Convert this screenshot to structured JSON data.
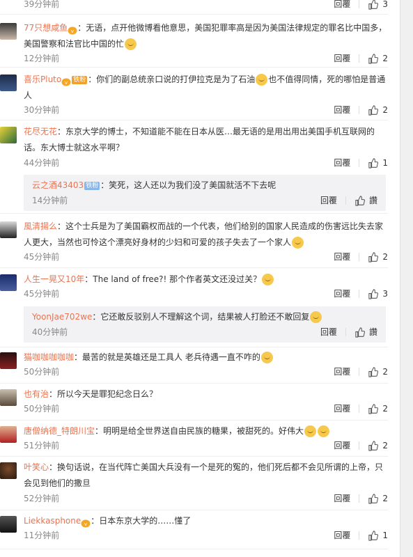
{
  "reply_label": "回覆",
  "sub_like_label": "讚",
  "comments": [
    {
      "text": "",
      "time": "39分钟前",
      "likes": "3"
    },
    {
      "name": "77只想咸鱼",
      "text": "：无语，点开他微博看他意思，美国犯罪率高是因为美国法律规定的罪名比中国多，美国警察和法官比中国的忙",
      "time": "12分钟前",
      "likes": "2"
    },
    {
      "name": "喜乐Pluto",
      "badge": "铁粉",
      "text": "：你们的副总统亲口说的打伊拉克是为了石油",
      "text2": "也不值得同情，死的哪怕是普通人",
      "time": "30分钟前",
      "likes": "2"
    },
    {
      "name": "花尽无花",
      "text": "：东京大学的博士，不知道能不能在日本从医…最无语的是用出用出美国手机互联网的话。东大博士就这水平啊？",
      "time": "44分钟前",
      "likes": "1",
      "sub": {
        "name": "云之酒43403",
        "badge": "铁粉",
        "text": "：笑死，这人还以为我们没了美国就活不下去呢",
        "time": "14分钟前"
      }
    },
    {
      "name": "風清揚么",
      "text": "：这个士兵是为了美国霸权而战的一个代表，他们给别的国家人民造成的伤害远比失去家人更大，当然也可怜这个漂亮好身材的少妇和可爱的孩子失去了一个家人",
      "time": "45分钟前",
      "likes": "2"
    },
    {
      "name": "人生一晃又10年",
      "text": "：The land of free?! 那个作者英文还没过关？",
      "time": "45分钟前",
      "likes": "3",
      "sub": {
        "name": "YoonJae702we",
        "text": "：它还敢反驳别人不理解这个词，结果被人打脸还不敢回复",
        "time": "40分钟前"
      }
    },
    {
      "name": "猫咖咖咖咖咖",
      "text": "：最苦的就是英雄还是工具人 老兵待遇一直不咋的",
      "time": "50分钟前",
      "likes": "2"
    },
    {
      "name": "也有治",
      "text": "：所以今天是罪犯纪念日么？",
      "time": "50分钟前",
      "likes": "2"
    },
    {
      "name": "唐僧纳德_特朗川宝",
      "text": "：明明是给全世界送自由民族的糖果，被甜死的。好伟大",
      "time": "51分钟前",
      "likes": "2"
    },
    {
      "name": "叶笑心",
      "text": "：换句话说，在当代阵亡美国大兵没有一个是死的冤的，他们死后都不会见所谓的上帝，只会见到他们的撒旦",
      "time": "52分钟前",
      "likes": "2"
    },
    {
      "name": "Liekkasphone",
      "text": "：日本东京大学的……懂了",
      "time": "11分钟前",
      "likes": "1"
    }
  ],
  "colors": {
    "username": "#eb7350",
    "meta": "#888888",
    "badge": "#8bb6e8",
    "background": "#ffffff"
  }
}
